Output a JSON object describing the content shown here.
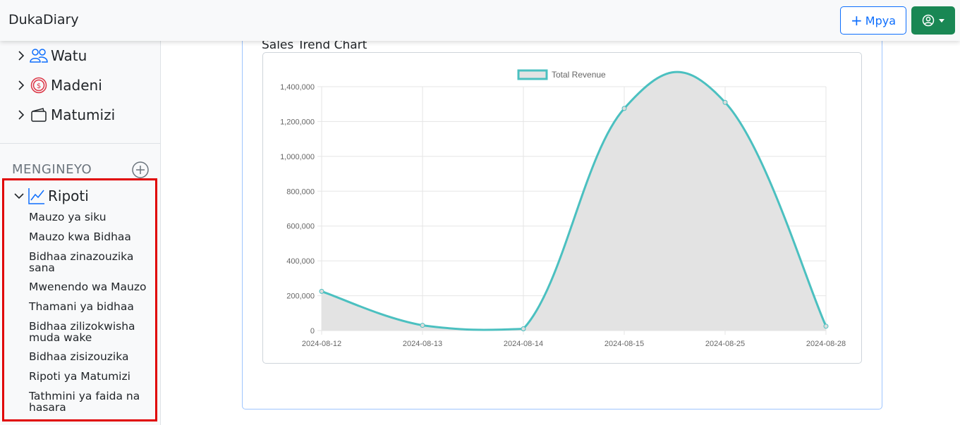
{
  "navbar": {
    "brand": "DukaDiary",
    "new_button_label": "Mpya",
    "new_button_icon": "plus-icon",
    "user_button_icon": "user-circle-icon",
    "accent_primary": "#0d6efd",
    "accent_success": "#198754"
  },
  "sidebar": {
    "items": [
      {
        "label": "Watu",
        "icon": "people-icon"
      },
      {
        "label": "Madeni",
        "icon": "dollar-coin-icon"
      },
      {
        "label": "Matumizi",
        "icon": "wallet-icon"
      }
    ],
    "section_title": "MENGINEYO",
    "reports": {
      "label": "Ripoti",
      "icon": "line-chart-icon",
      "expanded": true,
      "links": [
        "Mauzo ya siku",
        "Mauzo kwa Bidhaa",
        "Bidhaa zinazouzika sana",
        "Mwenendo wa Mauzo",
        "Thamani ya bidhaa",
        "Bidhaa zilizokwisha muda wake",
        "Bidhaa zisizouzika",
        "Ripoti ya Matumizi",
        "Tathmini ya faida na hasara"
      ]
    }
  },
  "main": {
    "card_title": "Sales Trend Chart"
  },
  "chart_data": {
    "type": "line",
    "title": "",
    "xlabel": "",
    "ylabel": "",
    "x": [
      "2024-08-12",
      "2024-08-13",
      "2024-08-14",
      "2024-08-15",
      "2024-08-25",
      "2024-08-28"
    ],
    "series": [
      {
        "name": "Total Revenue",
        "values": [
          225000,
          30000,
          10000,
          1275000,
          1310000,
          25000
        ],
        "color": "#4bc0c0",
        "fill": "#e3e3e3"
      }
    ],
    "ylim": [
      0,
      1400000
    ],
    "yticks": [
      0,
      200000,
      400000,
      600000,
      800000,
      1000000,
      1200000,
      1400000
    ],
    "grid": true,
    "legend_position": "top",
    "smooth": true
  }
}
